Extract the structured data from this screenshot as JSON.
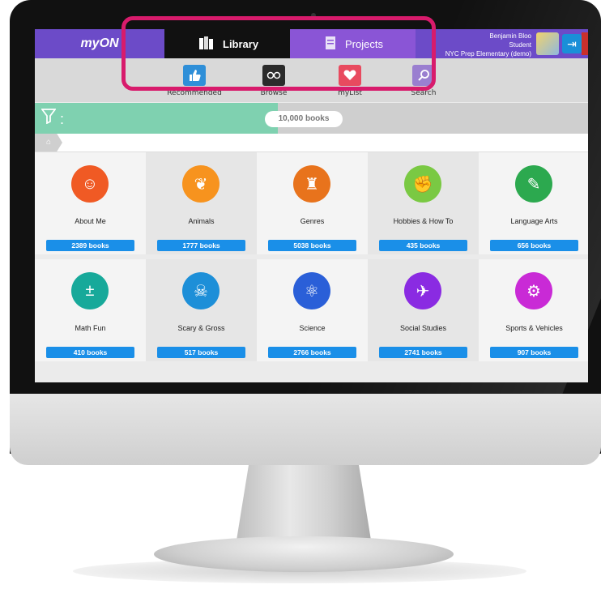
{
  "app": {
    "logo": "myON",
    "tabs": [
      "Library",
      "Projects"
    ],
    "user": {
      "name": "Benjamin Bloo",
      "role": "Student",
      "school": "NYC Prep Elementary (demo)"
    }
  },
  "subnav": {
    "items": [
      {
        "label": "Recommended",
        "icon": "thumbs-up-icon",
        "color": "#2f8fd8"
      },
      {
        "label": "Browse",
        "icon": "glasses-icon",
        "color": "#2b2b2b"
      },
      {
        "label": "myList",
        "icon": "heart-icon",
        "color": "#e84a5f"
      },
      {
        "label": "Search",
        "icon": "search-icon",
        "color": "#9a7fd0"
      }
    ]
  },
  "filter": {
    "label": ":",
    "book_count": "10,000 books"
  },
  "categories": [
    {
      "name": "About Me",
      "count": "2389 books",
      "color": "#f05a24",
      "glyph": "☺"
    },
    {
      "name": "Animals",
      "count": "1777 books",
      "color": "#f7931e",
      "glyph": "❦"
    },
    {
      "name": "Genres",
      "count": "5038 books",
      "color": "#e8731c",
      "glyph": "♜"
    },
    {
      "name": "Hobbies & How To",
      "count": "435 books",
      "color": "#7ac943",
      "glyph": "✊"
    },
    {
      "name": "Language Arts",
      "count": "656 books",
      "color": "#2ca94f",
      "glyph": "✎"
    },
    {
      "name": "Math Fun",
      "count": "410 books",
      "color": "#17a99a",
      "glyph": "±"
    },
    {
      "name": "Scary & Gross",
      "count": "517 books",
      "color": "#1d8fd8",
      "glyph": "☠"
    },
    {
      "name": "Science",
      "count": "2766 books",
      "color": "#2a5fd8",
      "glyph": "⚛"
    },
    {
      "name": "Social Studies",
      "count": "2741 books",
      "color": "#8a2be2",
      "glyph": "✈"
    },
    {
      "name": "Sports & Vehicles",
      "count": "907 books",
      "color": "#c92ad6",
      "glyph": "⚙"
    }
  ],
  "colors": {
    "highlight_border": "#d81b6c",
    "count_badge": "#1a8fe8",
    "topbar": "#6c4bc8"
  }
}
